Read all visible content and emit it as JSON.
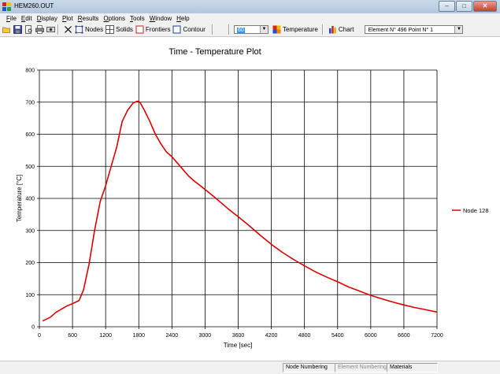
{
  "window": {
    "title": "HEM260.OUT",
    "buttons": [
      "–",
      "□",
      "✕"
    ]
  },
  "menu": [
    {
      "u": "F",
      "rest": "ile"
    },
    {
      "u": "E",
      "rest": "dit"
    },
    {
      "u": "D",
      "rest": "isplay"
    },
    {
      "u": "P",
      "rest": "lot"
    },
    {
      "u": "R",
      "rest": "esults"
    },
    {
      "u": "O",
      "rest": "ptions"
    },
    {
      "u": "T",
      "rest": "ools"
    },
    {
      "u": "W",
      "rest": "indow"
    },
    {
      "u": "H",
      "rest": "elp"
    }
  ],
  "toolbar": {
    "nodes_label": "Nodes",
    "solids_label": "Solids",
    "frontiers_label": "Frontiers",
    "contour_label": "Contour",
    "zoom_value": "60",
    "temperature_label": "Temperature",
    "chart_label": "Chart",
    "element_select": "Element N° 496   Point N° 1"
  },
  "statusbar": {
    "panels": [
      "Node Numbering",
      "Element Numbering",
      "Materials"
    ]
  },
  "colors": {
    "series": "#dd0000",
    "grid": "#000000"
  },
  "chart_data": {
    "type": "line",
    "title": "Time - Temperature Plot",
    "xlabel": "Time [sec]",
    "ylabel": "Temperature [°C]",
    "xlim": [
      0,
      7200
    ],
    "ylim": [
      0,
      800
    ],
    "xticks": [
      0,
      600,
      1200,
      1800,
      2400,
      3000,
      3600,
      4200,
      4800,
      5400,
      6000,
      6600,
      7200
    ],
    "yticks": [
      0,
      100,
      200,
      300,
      400,
      500,
      600,
      700,
      800
    ],
    "grid": true,
    "legend_position": "right",
    "series": [
      {
        "name": "Node 128",
        "color": "#dd0000",
        "x": [
          60,
          200,
          300,
          400,
          500,
          600,
          720,
          800,
          900,
          1000,
          1100,
          1200,
          1300,
          1400,
          1500,
          1600,
          1700,
          1780,
          1820,
          1900,
          2000,
          2100,
          2200,
          2300,
          2400,
          2500,
          2600,
          2700,
          2800,
          3000,
          3200,
          3400,
          3600,
          3800,
          4000,
          4200,
          4400,
          4600,
          4800,
          5000,
          5200,
          5400,
          5600,
          5800,
          6000,
          6200,
          6400,
          6600,
          6800,
          7000,
          7200
        ],
        "values": [
          18,
          30,
          45,
          55,
          65,
          72,
          82,
          115,
          195,
          300,
          390,
          440,
          500,
          560,
          640,
          675,
          698,
          703,
          700,
          675,
          640,
          600,
          570,
          545,
          530,
          510,
          490,
          470,
          455,
          428,
          400,
          370,
          343,
          315,
          285,
          257,
          232,
          210,
          190,
          171,
          155,
          140,
          124,
          111,
          98,
          87,
          77,
          68,
          60,
          53,
          46
        ]
      }
    ]
  }
}
